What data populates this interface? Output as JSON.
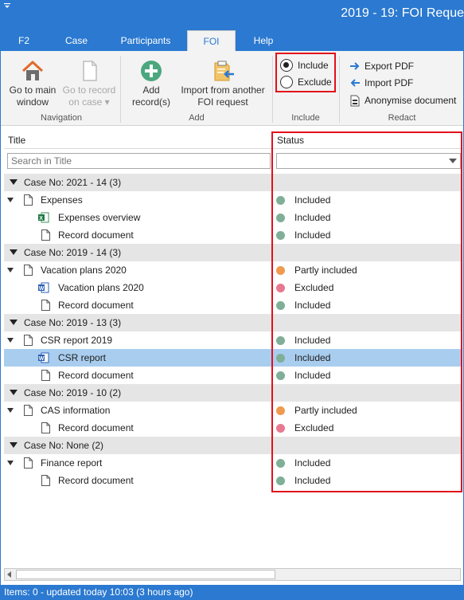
{
  "window": {
    "title": "2019 - 19: FOI Reque"
  },
  "tabs": [
    {
      "label": "F2"
    },
    {
      "label": "Case"
    },
    {
      "label": "Participants"
    },
    {
      "label": "FOI"
    },
    {
      "label": "Help"
    }
  ],
  "ribbon": {
    "navigation": {
      "label": "Navigation",
      "go_main_line1": "Go to main",
      "go_main_line2": "window",
      "go_record_line1": "Go to record",
      "go_record_line2": "on case ▾"
    },
    "add": {
      "label": "Add",
      "add_records_line1": "Add",
      "add_records_line2": "record(s)",
      "import_line1": "Import from another",
      "import_line2": "FOI request"
    },
    "include": {
      "label": "Include",
      "include_option": "Include",
      "exclude_option": "Exclude",
      "selected": "Include"
    },
    "redact": {
      "label": "Redact",
      "export_pdf": "Export PDF",
      "import_pdf": "Import PDF",
      "anonymise": "Anonymise document"
    }
  },
  "grid": {
    "col_title": "Title",
    "col_status": "Status",
    "search_placeholder": "Search in Title",
    "status_filter_value": ""
  },
  "rows": [
    {
      "kind": "group",
      "label": "Case No: 2021 - 14 (3)"
    },
    {
      "kind": "parent",
      "title": "Expenses",
      "status": "Included",
      "status_color": "#7faf96"
    },
    {
      "kind": "child",
      "icon": "excel",
      "title": "Expenses overview",
      "status": "Included",
      "status_color": "#7faf96"
    },
    {
      "kind": "child",
      "icon": "doc",
      "title": "Record document",
      "status": "Included",
      "status_color": "#7faf96"
    },
    {
      "kind": "group",
      "label": "Case No: 2019 - 14 (3)"
    },
    {
      "kind": "parent",
      "title": "Vacation plans 2020",
      "status": "Partly included",
      "status_color": "#ef9a4f"
    },
    {
      "kind": "child",
      "icon": "word",
      "title": "Vacation plans 2020",
      "status": "Excluded",
      "status_color": "#e8788f"
    },
    {
      "kind": "child",
      "icon": "doc",
      "title": "Record document",
      "status": "Included",
      "status_color": "#7faf96"
    },
    {
      "kind": "group",
      "label": "Case No: 2019 - 13 (3)"
    },
    {
      "kind": "parent",
      "title": "CSR report 2019",
      "status": "Included",
      "status_color": "#7faf96"
    },
    {
      "kind": "child",
      "icon": "word",
      "title": "CSR report",
      "status": "Included",
      "status_color": "#7faf96",
      "selected": true
    },
    {
      "kind": "child",
      "icon": "doc",
      "title": "Record document",
      "status": "Included",
      "status_color": "#7faf96"
    },
    {
      "kind": "group",
      "label": "Case No: 2019 - 10 (2)"
    },
    {
      "kind": "parent",
      "title": "CAS information",
      "status": "Partly included",
      "status_color": "#ef9a4f"
    },
    {
      "kind": "child",
      "icon": "doc",
      "title": "Record document",
      "status": "Excluded",
      "status_color": "#e8788f"
    },
    {
      "kind": "group",
      "label": "Case No: None (2)"
    },
    {
      "kind": "parent",
      "title": "Finance report",
      "status": "Included",
      "status_color": "#7faf96"
    },
    {
      "kind": "child",
      "icon": "doc",
      "title": "Record document",
      "status": "Included",
      "status_color": "#7faf96"
    }
  ],
  "statusbar": {
    "text": "Items: 0 - updated today 10:03 (3 hours ago)"
  },
  "colors": {
    "brand": "#2b79d0",
    "highlight": "#e2101b",
    "selection": "#a9cdee"
  }
}
